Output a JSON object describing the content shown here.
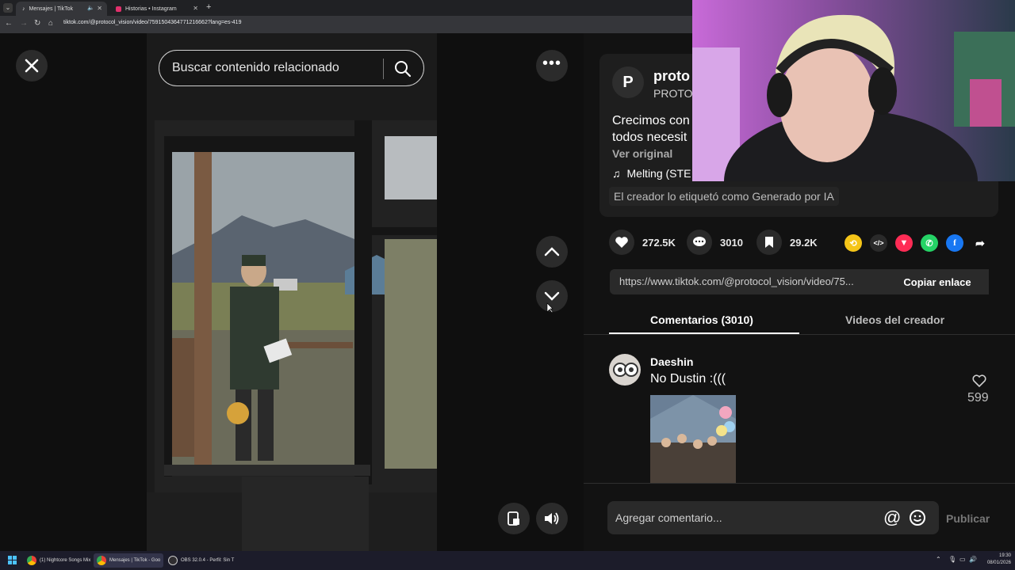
{
  "browser": {
    "tabs": [
      {
        "label": "Mensajes | TikTok",
        "active": true
      },
      {
        "label": "Historias • Instagram",
        "active": false
      }
    ],
    "new_tab": "+",
    "url": "tiktok.com/@protocol_vision/video/7591504364771216662?lang=es-419"
  },
  "video": {
    "search_placeholder": "Buscar contenido relacionado"
  },
  "post": {
    "author_name": "proto",
    "author_handle": "PROTOC",
    "description_line1": "Crecimos con",
    "description_line2": "todos necesit",
    "see_original": "Ver original",
    "music": "Melting (STE",
    "ai_label": "El creador lo etiquetó como Generado por IA"
  },
  "stats": {
    "likes": "272.5K",
    "comments": "3010",
    "saves": "29.2K"
  },
  "share": {
    "link": "https://www.tiktok.com/@protocol_vision/video/75...",
    "copy_label": "Copiar enlace"
  },
  "tabs": {
    "comments": "Comentarios (3010)",
    "creator_videos": "Videos del creador"
  },
  "comments": [
    {
      "author": "Daeshin",
      "text": "No Dustin :(((",
      "likes": "599"
    }
  ],
  "comment_input": {
    "placeholder": "Agregar comentario...",
    "publish": "Publicar"
  },
  "taskbar": {
    "apps": [
      {
        "label": "(1) Nightcore Songs Mix"
      },
      {
        "label": "Mensajes | TikTok - Goo"
      },
      {
        "label": "OBS 32.0.4 - Perfil: Sin T"
      }
    ],
    "time": "19:30",
    "date": "08/01/2026"
  },
  "colors": {
    "accent_pink": "#fe2c55",
    "tiktok_bg": "#121212"
  }
}
